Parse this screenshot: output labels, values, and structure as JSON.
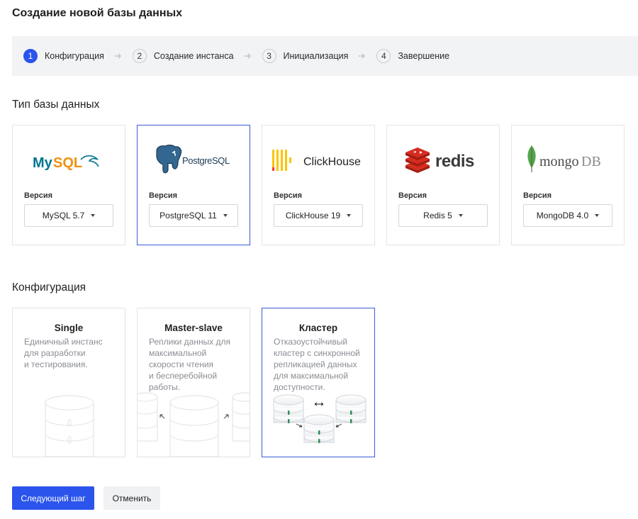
{
  "page": {
    "title": "Создание новой базы данных"
  },
  "stepper": {
    "steps": [
      {
        "num": "1",
        "label": "Конфигурация",
        "active": true
      },
      {
        "num": "2",
        "label": "Создание инстанса",
        "active": false
      },
      {
        "num": "3",
        "label": "Инициализация",
        "active": false
      },
      {
        "num": "4",
        "label": "Завершение",
        "active": false
      }
    ]
  },
  "db_section": {
    "title": "Тип базы данных",
    "version_label": "Версия",
    "types": [
      {
        "name": "MySQL",
        "logo_text": "MySQL",
        "version": "MySQL 5.7",
        "selected": false
      },
      {
        "name": "PostgreSQL",
        "logo_text": "PostgreSQL",
        "version": "PostgreSQL 11",
        "selected": true
      },
      {
        "name": "ClickHouse",
        "logo_text": "ClickHouse",
        "version": "ClickHouse 19",
        "selected": false
      },
      {
        "name": "Redis",
        "logo_text": "redis",
        "version": "Redis 5",
        "selected": false
      },
      {
        "name": "MongoDB",
        "logo_text": "mongoDB",
        "version": "MongoDB 4.0",
        "selected": false
      }
    ]
  },
  "config_section": {
    "title": "Конфигурация",
    "options": [
      {
        "title": "Single",
        "desc": [
          "Единичный инстанс",
          "для разработки",
          "и тестирования."
        ],
        "selected": false
      },
      {
        "title": "Master-slave",
        "desc": [
          "Реплики данных для",
          "максимальной",
          "скорости чтения",
          "и бесперебойной",
          "работы."
        ],
        "selected": false
      },
      {
        "title": "Кластер",
        "desc": [
          "Отказоустойчивый",
          "кластер с синхронной",
          "репликацией данных",
          "для максимальной",
          "доступности."
        ],
        "selected": true
      }
    ]
  },
  "actions": {
    "next_label": "Следующий шаг",
    "cancel_label": "Отменить"
  },
  "colors": {
    "accent": "#2a54ec",
    "selected_border": "#3a5bd6",
    "mysql_blue": "#00758f",
    "mysql_orange": "#f29111",
    "postgres_blue": "#336791",
    "clickhouse_yellow": "#fcc400",
    "clickhouse_red": "#ff3a3a",
    "redis_red": "#d82c20",
    "mongo_green": "#4fa94d"
  }
}
